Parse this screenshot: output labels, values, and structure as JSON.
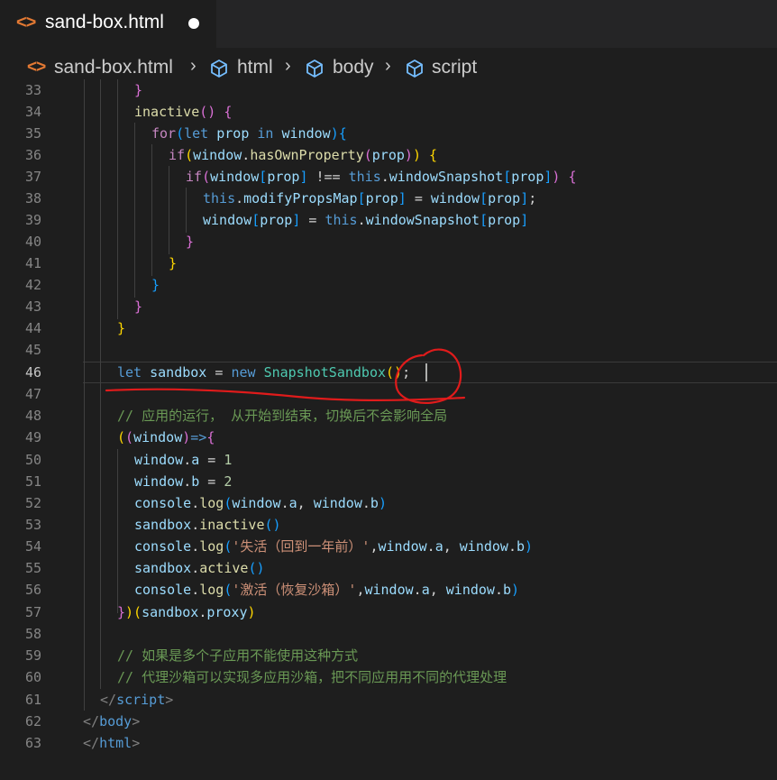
{
  "tab": {
    "icon": "html-file-icon",
    "title": "sand-box.html",
    "dirty_indicator": "unsaved-dot"
  },
  "breadcrumb": {
    "file": "sand-box.html",
    "items": [
      "html",
      "body",
      "script"
    ]
  },
  "editor": {
    "current_line": 46,
    "line_numbers": [
      "33",
      "34",
      "35",
      "36",
      "37",
      "38",
      "39",
      "40",
      "41",
      "42",
      "43",
      "44",
      "45",
      "46",
      "47",
      "48",
      "49",
      "50",
      "51",
      "52",
      "53",
      "54",
      "55",
      "56",
      "57",
      "58",
      "59",
      "60",
      "61",
      "62",
      "63"
    ],
    "comments": {
      "l48": "// 应用的运行， 从开始到结束，切换后不会影响全局",
      "l59": "// 如果是多个子应用不能使用这种方式",
      "l60": "// 代理沙箱可以实现多应用沙箱，把不同应用用不同的代理处理"
    },
    "strings": {
      "l54": "'失活（回到一年前）'",
      "l56": "'激活（恢复沙箱）'"
    }
  },
  "colors": {
    "background": "#1e1e1e",
    "tab_bar": "#252526",
    "keyword": "#569cd6",
    "control": "#c586c0",
    "variable": "#9cdcfe",
    "function": "#dcdcaa",
    "class": "#4ec9b0",
    "comment": "#6a9955",
    "string": "#ce9178",
    "annotation": "#e01b1b"
  }
}
